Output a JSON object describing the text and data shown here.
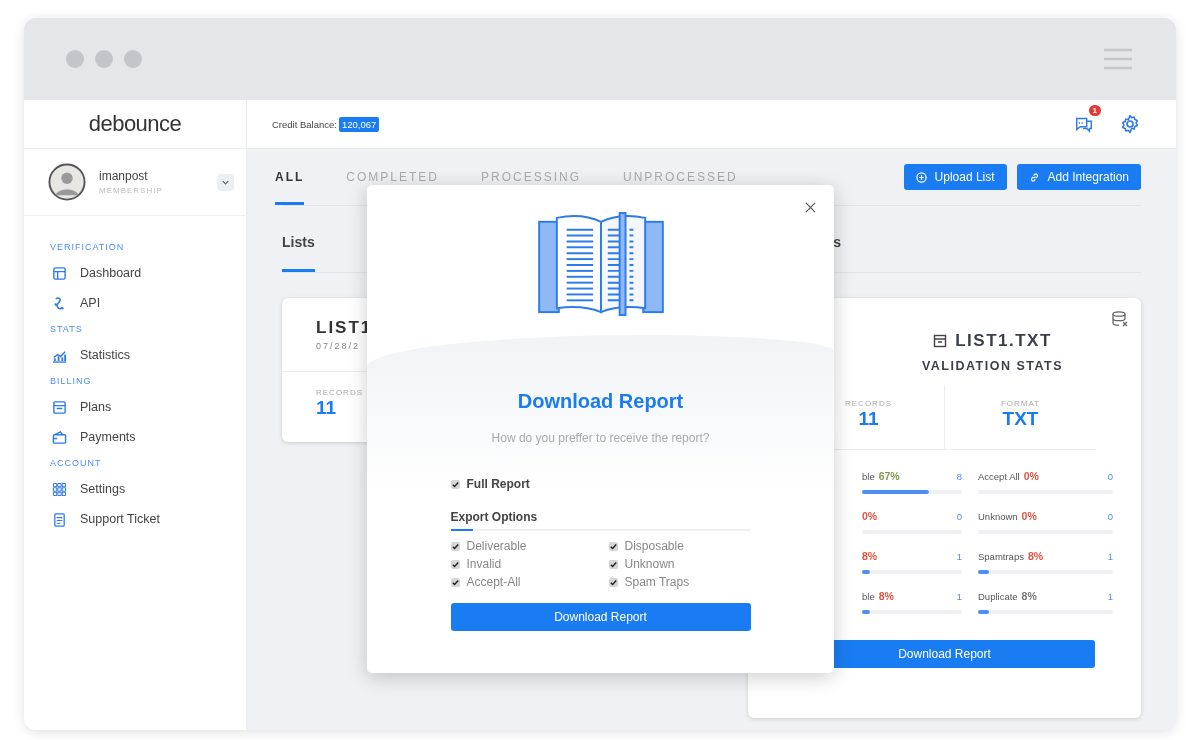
{
  "sidebar": {
    "logo": "debounce",
    "user": {
      "name": "imanpost",
      "role": "MEMBERSHIP"
    },
    "sections": [
      {
        "heading": "VERIFICATION",
        "items": [
          {
            "label": "Dashboard"
          },
          {
            "label": "API"
          }
        ]
      },
      {
        "heading": "STATS",
        "items": [
          {
            "label": "Statistics"
          }
        ]
      },
      {
        "heading": "BILLING",
        "items": [
          {
            "label": "Plans"
          },
          {
            "label": "Payments"
          }
        ]
      },
      {
        "heading": "ACCOUNT",
        "items": [
          {
            "label": "Settings"
          },
          {
            "label": "Support Ticket"
          }
        ]
      }
    ]
  },
  "header": {
    "credit_label": "Credit Balance:",
    "credit_value": "120,067",
    "notifications": "1"
  },
  "tabs": [
    {
      "label": "ALL",
      "selected": true
    },
    {
      "label": "COMPLETED",
      "selected": false
    },
    {
      "label": "PROCESSING",
      "selected": false
    },
    {
      "label": "UNPROCESSED",
      "selected": false
    }
  ],
  "actions": [
    {
      "label": "Upload List"
    },
    {
      "label": "Add Integration"
    }
  ],
  "sections": [
    {
      "label": "Lists",
      "selected": true
    },
    {
      "label": "s",
      "selected": false
    }
  ],
  "list_card": {
    "title": "LIST1",
    "date": "07/28/2",
    "records_label": "RECORDS",
    "records": "11"
  },
  "stats_card": {
    "title": "LIST1.TXT",
    "subtitle": "VALIDATION STATS",
    "records_label": "RECORDS",
    "records": "11",
    "format_label": "FORMAT",
    "format": "TXT",
    "stats": [
      {
        "label": "ble",
        "percent": "67%",
        "color": "#7c9c4c",
        "count": "8",
        "level": 0.67
      },
      {
        "label": "Accept All",
        "percent": "0%",
        "color": "#e0533f",
        "count": "0"
      },
      {
        "percent": "0%",
        "color": "#e0533f",
        "count": "0"
      },
      {
        "label": "Unknown",
        "percent": "0%",
        "color": "#e0533f",
        "count": "0"
      },
      {
        "percent": "8%",
        "color": "#e0533f",
        "count": "1",
        "level": 0.08
      },
      {
        "label": "Spamtraps",
        "percent": "8%",
        "color": "#e0533f",
        "count": "1",
        "level": 0.08
      },
      {
        "label": "ble",
        "percent": "8%",
        "color": "#e0533f",
        "count": "1",
        "level": 0.08
      },
      {
        "label": "Duplicate",
        "percent": "8%",
        "color": "#777777",
        "count": "1",
        "level": 0.08
      }
    ],
    "button": "Download Report"
  },
  "modal": {
    "title": "Download Report",
    "subtitle": "How do you preffer to receive the report?",
    "full_report": {
      "label": "Full Report",
      "checked": true
    },
    "options_heading": "Export Options",
    "options": [
      {
        "label": "Deliverable",
        "checked": true
      },
      {
        "label": "Disposable",
        "checked": true
      },
      {
        "label": "Invalid",
        "checked": true
      },
      {
        "label": "Unknown",
        "checked": true
      },
      {
        "label": "Accept-All",
        "checked": true
      },
      {
        "label": "Spam Traps",
        "checked": true
      }
    ],
    "button": "Download Report"
  }
}
